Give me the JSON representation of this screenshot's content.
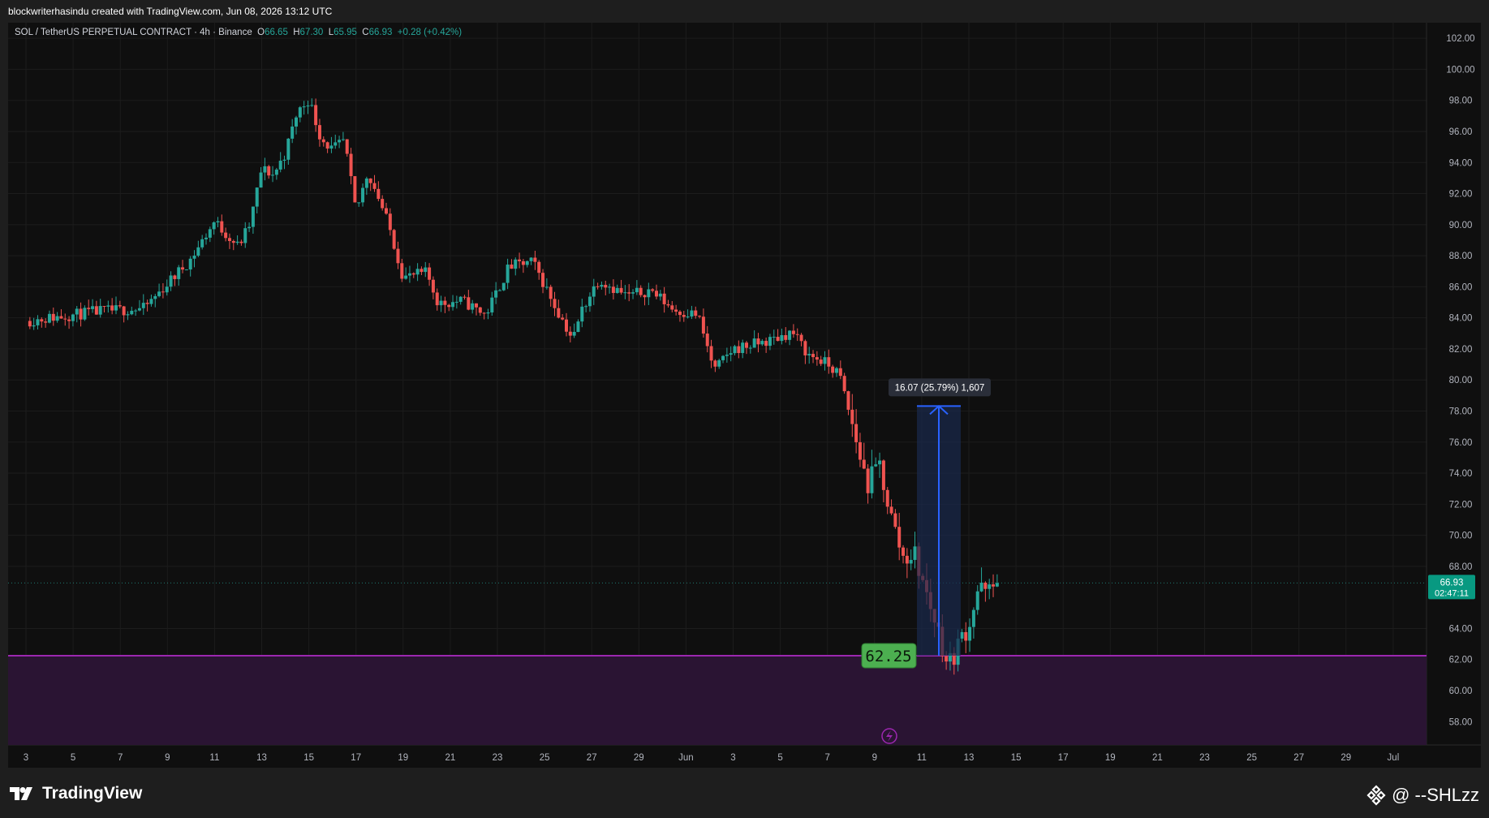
{
  "header": {
    "credit": "blockwriterhasindu created with TradingView.com, Jun 08, 2026 13:12 UTC"
  },
  "legend": {
    "symbol": "SOL / TetherUS PERPETUAL CONTRACT · 4h · Binance",
    "o_label": "O",
    "o_value": "66.65",
    "h_label": "H",
    "h_value": "67.30",
    "l_label": "L",
    "l_value": "65.95",
    "c_label": "C",
    "c_value": "66.93",
    "change": "+0.28 (+0.42%)"
  },
  "price_badge": {
    "price": "66.93",
    "countdown": "02:47:11"
  },
  "measure": {
    "label": "16.07 (25.79%) 1,607",
    "from": 62.25,
    "to": 78.32
  },
  "support": {
    "label": "62.25",
    "level": 62.25
  },
  "footer": {
    "logo_text": "TradingView",
    "watermark": "@ --SHLzz"
  },
  "colors": {
    "up": "#26a69a",
    "down": "#ef5350",
    "support": "#9c27b0",
    "measure": "#2962ff",
    "badge": "#089981"
  },
  "chart_data": {
    "type": "candlestick",
    "title": "SOL / TetherUS PERPETUAL CONTRACT · 4h · Binance",
    "ylim": [
      56.5,
      103
    ],
    "yticks": [
      "102.00",
      "100.00",
      "98.00",
      "96.00",
      "94.00",
      "92.00",
      "90.00",
      "88.00",
      "86.00",
      "84.00",
      "82.00",
      "80.00",
      "78.00",
      "76.00",
      "74.00",
      "72.00",
      "70.00",
      "68.00",
      "64.00",
      "62.00",
      "60.00",
      "58.00"
    ],
    "xticks": [
      "3",
      "5",
      "7",
      "9",
      "11",
      "13",
      "15",
      "17",
      "19",
      "21",
      "23",
      "25",
      "27",
      "29",
      "Jun",
      "3",
      "5",
      "7",
      "9",
      "11",
      "13",
      "15",
      "17",
      "19",
      "21",
      "23",
      "25",
      "27",
      "29",
      "Jul"
    ],
    "last_price": 66.93,
    "grid": true,
    "close_path": [
      [
        0,
        83.8
      ],
      [
        3,
        84.4
      ],
      [
        5,
        84.6
      ],
      [
        7,
        87.8
      ],
      [
        8,
        90.2
      ],
      [
        9,
        88.6
      ],
      [
        9.5,
        90
      ],
      [
        10,
        93.6
      ],
      [
        10.5,
        93.2
      ],
      [
        11,
        94.6
      ],
      [
        11.5,
        97.2
      ],
      [
        12,
        98.1
      ],
      [
        12.5,
        95.6
      ],
      [
        13,
        94.8
      ],
      [
        13.5,
        95.4
      ],
      [
        14,
        90.8
      ],
      [
        14.5,
        93.4
      ],
      [
        15,
        91.6
      ],
      [
        15.5,
        89.4
      ],
      [
        16,
        86.6
      ],
      [
        17,
        86.9
      ],
      [
        17.5,
        84.9
      ],
      [
        18.5,
        85.1
      ],
      [
        19.5,
        84.2
      ],
      [
        20.5,
        87.3
      ],
      [
        21.5,
        87.6
      ],
      [
        22.5,
        84.6
      ],
      [
        23.2,
        82.6
      ],
      [
        23.6,
        84.6
      ],
      [
        24.3,
        86.5
      ],
      [
        25.5,
        85.4
      ],
      [
        26.5,
        85.8
      ],
      [
        27.5,
        84.5
      ],
      [
        28.5,
        84.2
      ],
      [
        29.2,
        80.6
      ],
      [
        30,
        82
      ],
      [
        31.5,
        82.5
      ],
      [
        32.5,
        83.1
      ],
      [
        33.2,
        81.6
      ],
      [
        33.8,
        81.2
      ],
      [
        34.5,
        80.4
      ],
      [
        35.2,
        76.2
      ],
      [
        35.7,
        73.2
      ],
      [
        36.2,
        74.6
      ],
      [
        36.7,
        71.2
      ],
      [
        37.2,
        68.6
      ],
      [
        37.7,
        68.8
      ],
      [
        38.2,
        66.2
      ],
      [
        38.6,
        64.4
      ],
      [
        38.9,
        62.8
      ],
      [
        39.1,
        61.6
      ],
      [
        39.3,
        62.1
      ],
      [
        39.6,
        63.2
      ],
      [
        40,
        64.2
      ],
      [
        40.4,
        66.6
      ],
      [
        40.8,
        66.2
      ],
      [
        41.2,
        66.93
      ]
    ]
  }
}
